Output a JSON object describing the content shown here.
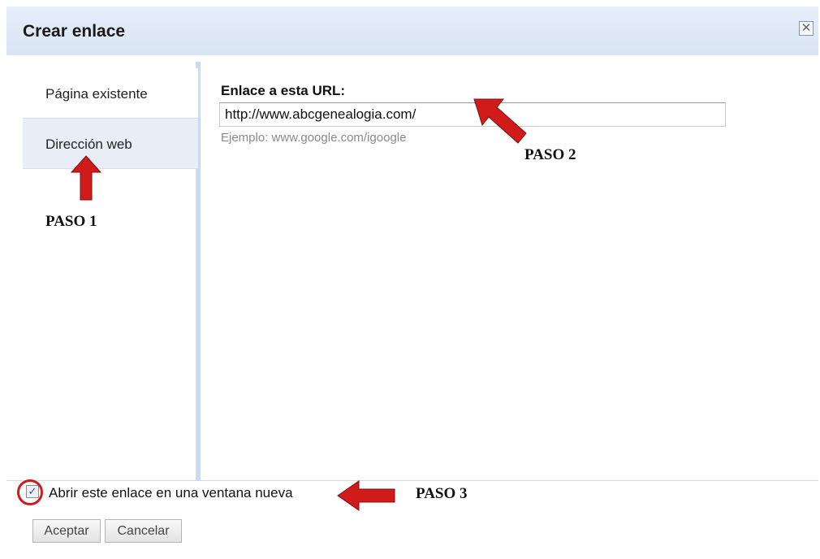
{
  "dialog": {
    "title": "Crear enlace",
    "close_icon": "close-icon"
  },
  "tabs": [
    {
      "label": "Página existente"
    },
    {
      "label": "Dirección web"
    }
  ],
  "main": {
    "url_label": "Enlace a esta URL:",
    "url_value": "http://www.abcgenealogia.com/",
    "example": "Ejemplo: www.google.com/igoogle"
  },
  "footer": {
    "checkbox_label": "Abrir este enlace en una ventana nueva",
    "checkbox_checked": true,
    "accept_label": "Aceptar",
    "cancel_label": "Cancelar"
  },
  "annotations": {
    "step1": "PASO 1",
    "step2": "PASO 2",
    "step3": "PASO 3",
    "arrow_color": "#d11b1b"
  }
}
